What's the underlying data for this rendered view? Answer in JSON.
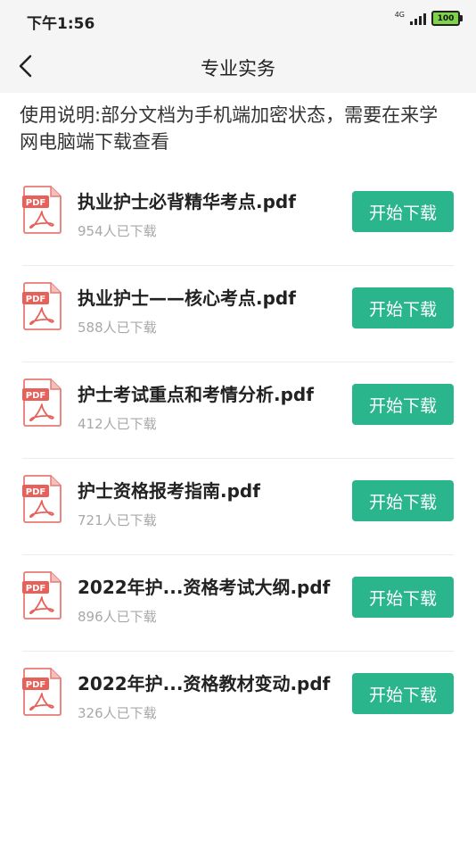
{
  "status": {
    "time": "下午1:56",
    "network": "4G",
    "battery": "100"
  },
  "nav": {
    "title": "专业实务"
  },
  "notice": "使用说明:部分文档为手机端加密状态，需要在来学网电脑端下载查看",
  "icon_label": "PDF",
  "accent_color": "#2ab58c",
  "files": [
    {
      "name": "执业护士必背精华考点.pdf",
      "count": "954人已下载",
      "button": "开始下载"
    },
    {
      "name": "执业护士——核心考点.pdf",
      "count": "588人已下载",
      "button": "开始下载"
    },
    {
      "name": "护士考试重点和考情分析.pdf",
      "count": "412人已下载",
      "button": "开始下载"
    },
    {
      "name": "护士资格报考指南.pdf",
      "count": "721人已下载",
      "button": "开始下载"
    },
    {
      "name": "2022年护...资格考试大纲.pdf",
      "count": "896人已下载",
      "button": "开始下载"
    },
    {
      "name": "2022年护...资格教材变动.pdf",
      "count": "326人已下载",
      "button": "开始下载"
    }
  ]
}
